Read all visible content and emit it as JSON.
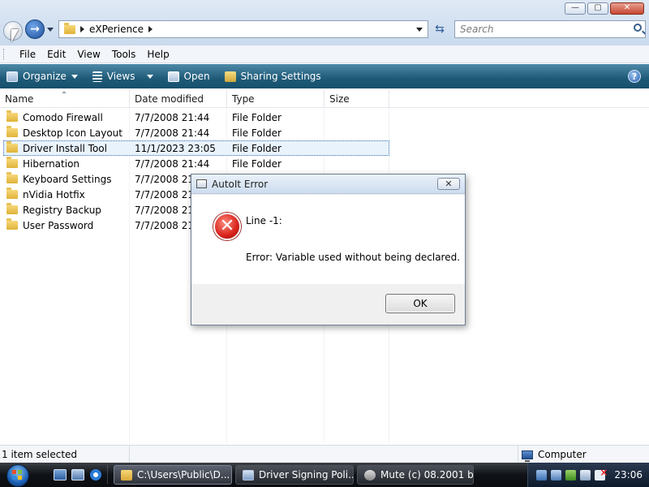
{
  "window": {
    "buttons": {
      "minimize": "—",
      "maximize": "▢",
      "close": "✕"
    }
  },
  "address": {
    "path": "eXPerience",
    "search_placeholder": "Search"
  },
  "menu": [
    "File",
    "Edit",
    "View",
    "Tools",
    "Help"
  ],
  "commands": {
    "organize": "Organize",
    "views": "Views",
    "open": "Open",
    "sharing": "Sharing Settings"
  },
  "columns": {
    "name": "Name",
    "date": "Date modified",
    "type": "Type",
    "size": "Size"
  },
  "files": [
    {
      "name": "Comodo Firewall",
      "date": "7/7/2008 21:44",
      "type": "File Folder"
    },
    {
      "name": "Desktop Icon Layout",
      "date": "7/7/2008 21:44",
      "type": "File Folder"
    },
    {
      "name": "Driver Install Tool",
      "date": "11/1/2023 23:05",
      "type": "File Folder"
    },
    {
      "name": "Hibernation",
      "date": "7/7/2008 21:44",
      "type": "File Folder"
    },
    {
      "name": "Keyboard Settings",
      "date": "7/7/2008 21:4",
      "type": ""
    },
    {
      "name": "nVidia Hotfix",
      "date": "7/7/2008 21:4",
      "type": ""
    },
    {
      "name": "Registry Backup",
      "date": "7/7/2008 21:4",
      "type": ""
    },
    {
      "name": "User Password",
      "date": "7/7/2008 21:4",
      "type": ""
    }
  ],
  "status": {
    "left": "1 item selected",
    "right": "Computer"
  },
  "dialog": {
    "title": "AutoIt Error",
    "line1": "Line -1:",
    "line2": "Error: Variable used without being declared.",
    "ok": "OK",
    "close": "✕"
  },
  "taskbar": {
    "items": [
      "C:\\Users\\Public\\D...",
      "Driver Signing Poli...",
      "Mute (c) 08.2001 b..."
    ],
    "clock": "23:06"
  },
  "icons": {
    "back": "back-arrow-icon",
    "forward": "forward-arrow-icon",
    "folder": "folder-icon",
    "error": "error-icon"
  }
}
